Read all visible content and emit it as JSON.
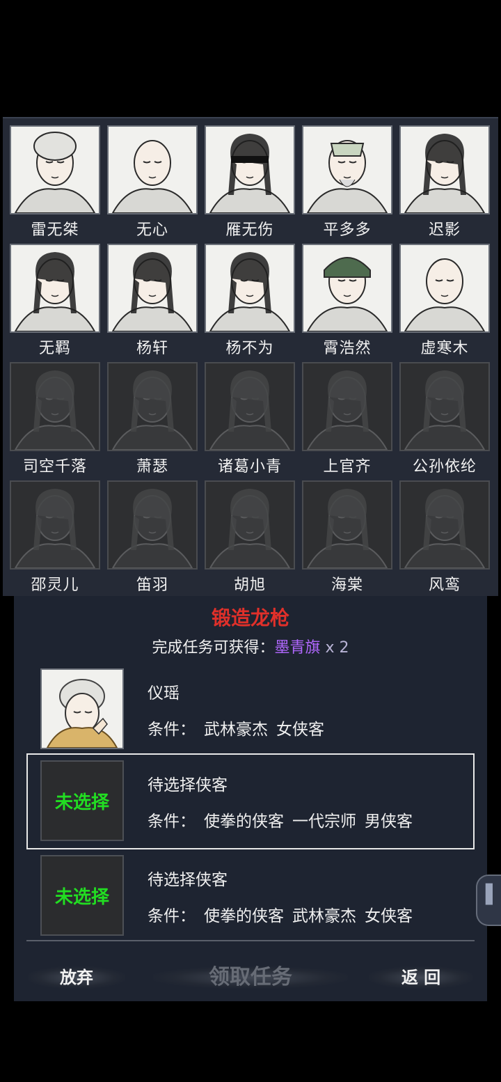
{
  "heroes": [
    {
      "name": "雷无桀",
      "unlocked": true,
      "icon": "portrait-monk-cap"
    },
    {
      "name": "无心",
      "unlocked": true,
      "icon": "portrait-bald-monk"
    },
    {
      "name": "雁无伤",
      "unlocked": true,
      "icon": "portrait-blindfold"
    },
    {
      "name": "平多多",
      "unlocked": true,
      "icon": "portrait-bearded-man"
    },
    {
      "name": "迟影",
      "unlocked": true,
      "icon": "portrait-wild-hair"
    },
    {
      "name": "无羁",
      "unlocked": true,
      "icon": "portrait-ponytail"
    },
    {
      "name": "杨轩",
      "unlocked": true,
      "icon": "portrait-long-hair"
    },
    {
      "name": "杨不为",
      "unlocked": true,
      "icon": "portrait-long-hair"
    },
    {
      "name": "霄浩然",
      "unlocked": true,
      "icon": "portrait-fur-hat"
    },
    {
      "name": "虚寒木",
      "unlocked": true,
      "icon": "portrait-bald-monk"
    },
    {
      "name": "司空千落",
      "unlocked": false,
      "icon": "portrait-locked"
    },
    {
      "name": "萧瑟",
      "unlocked": false,
      "icon": "portrait-locked"
    },
    {
      "name": "诸葛小青",
      "unlocked": false,
      "icon": "portrait-locked"
    },
    {
      "name": "上官齐",
      "unlocked": false,
      "icon": "portrait-locked"
    },
    {
      "name": "公孙依纶",
      "unlocked": false,
      "icon": "portrait-locked"
    },
    {
      "name": "邵灵儿",
      "unlocked": false,
      "icon": "portrait-locked"
    },
    {
      "name": "笛羽",
      "unlocked": false,
      "icon": "portrait-locked"
    },
    {
      "name": "胡旭",
      "unlocked": false,
      "icon": "portrait-locked"
    },
    {
      "name": "海棠",
      "unlocked": false,
      "icon": "portrait-locked"
    },
    {
      "name": "风鸾",
      "unlocked": false,
      "icon": "portrait-locked"
    }
  ],
  "quest": {
    "title": "锻造龙枪",
    "reward_prefix": "完成任务可获得：",
    "reward_item": "墨青旗",
    "reward_count": "x 2",
    "slots": [
      {
        "name": "仪瑶",
        "filled": true,
        "cond_label": "条件：",
        "conditions": [
          "武林豪杰",
          "女侠客"
        ]
      },
      {
        "name": "待选择侠客",
        "filled": false,
        "placeholder": "未选择",
        "cond_label": "条件：",
        "conditions": [
          "使拳的侠客",
          "一代宗师",
          "男侠客"
        ]
      },
      {
        "name": "待选择侠客",
        "filled": false,
        "placeholder": "未选择",
        "cond_label": "条件：",
        "conditions": [
          "使拳的侠客",
          "武林豪杰",
          "女侠客"
        ]
      }
    ]
  },
  "buttons": {
    "abandon": "放弃",
    "accept": "领取任务",
    "back": "返 回"
  },
  "colors": {
    "title_red": "#e0302a",
    "reward_purple": "#b168ff",
    "unselected_green": "#22dd22",
    "panel_bg": "#1e2431"
  }
}
